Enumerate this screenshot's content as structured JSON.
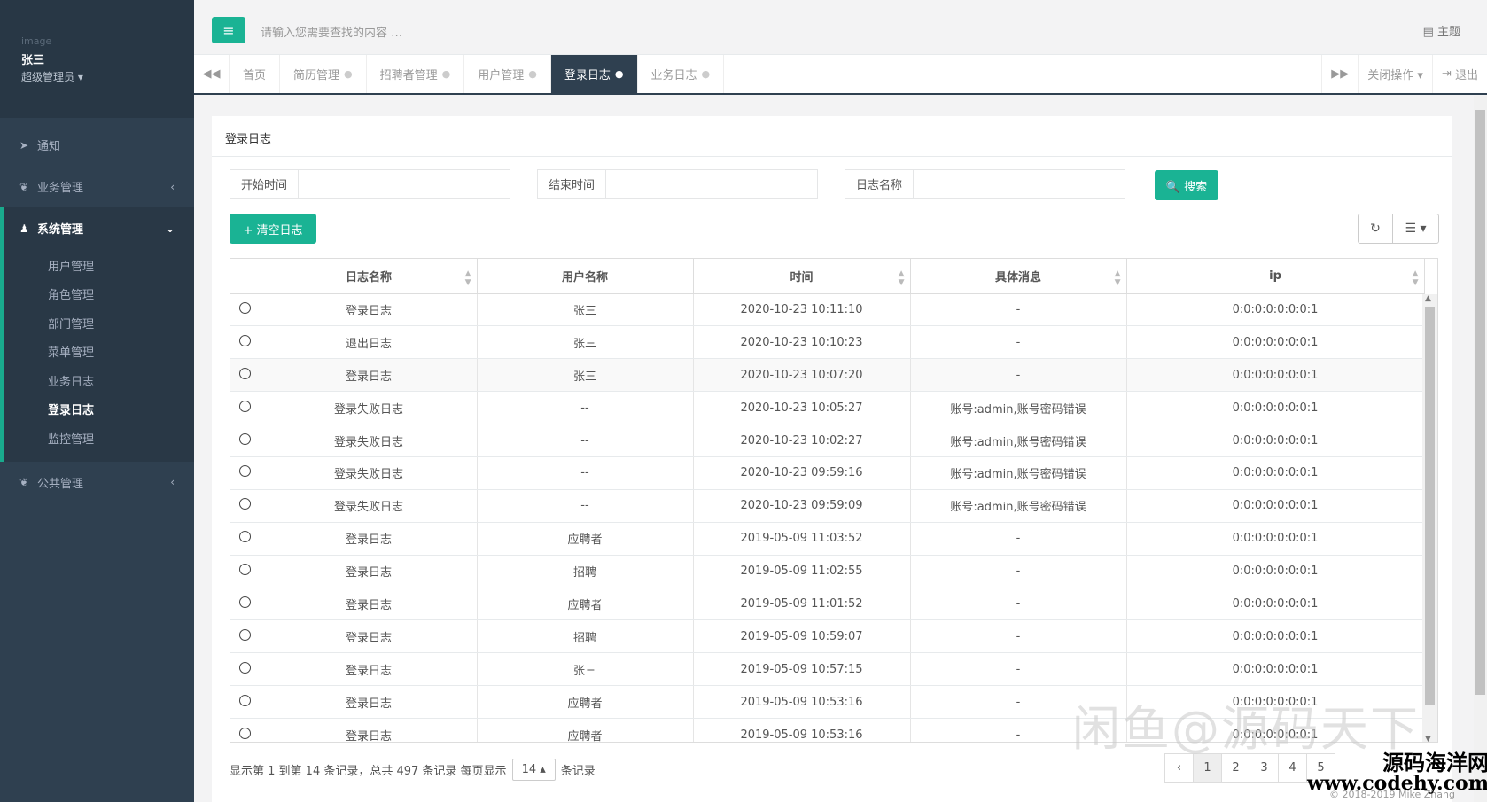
{
  "sidebar": {
    "profile": {
      "image_alt": "image",
      "name": "张三",
      "role": "超级管理员 ▾"
    },
    "items": [
      {
        "label": "通知",
        "icon": "paper-plane-icon"
      },
      {
        "label": "业务管理",
        "icon": "leaf-icon",
        "arrow": "‹"
      },
      {
        "label": "系统管理",
        "icon": "user-icon",
        "arrow": "⌄"
      },
      {
        "label": "公共管理",
        "icon": "leaf-icon",
        "arrow": "‹"
      }
    ],
    "sub_items": [
      "用户管理",
      "角色管理",
      "部门管理",
      "菜单管理",
      "业务日志",
      "登录日志",
      "监控管理"
    ]
  },
  "topbar": {
    "menu_icon": "≡",
    "search_placeholder": "请输入您需要查找的内容 …",
    "theme_label": "▤ 主题"
  },
  "tabs": {
    "prev": "◀◀",
    "next": "▶▶",
    "items": [
      {
        "label": "首页",
        "close": ""
      },
      {
        "label": "简历管理",
        "close": "●"
      },
      {
        "label": "招聘者管理",
        "close": "●"
      },
      {
        "label": "用户管理",
        "close": "●"
      },
      {
        "label": "登录日志",
        "close": "●"
      },
      {
        "label": "业务日志",
        "close": "●"
      }
    ],
    "close_ops": "关闭操作 ▾",
    "logout": "退出"
  },
  "panel": {
    "title": "登录日志",
    "filters": {
      "start_label": "开始时间",
      "end_label": "结束时间",
      "name_label": "日志名称"
    },
    "search_button": "🔍 搜索",
    "clear_button": "+ 清空日志",
    "refresh_icon": "↻",
    "columns_icon": "☰ ▾"
  },
  "table": {
    "headers": [
      "日志名称",
      "用户名称",
      "时间",
      "具体消息",
      "ip"
    ],
    "rows": [
      [
        "登录日志",
        "张三",
        "2020-10-23 10:11:10",
        "-",
        "0:0:0:0:0:0:0:1"
      ],
      [
        "退出日志",
        "张三",
        "2020-10-23 10:10:23",
        "-",
        "0:0:0:0:0:0:0:1"
      ],
      [
        "登录日志",
        "张三",
        "2020-10-23 10:07:20",
        "-",
        "0:0:0:0:0:0:0:1"
      ],
      [
        "登录失败日志",
        "--",
        "2020-10-23 10:05:27",
        "账号:admin,账号密码错误",
        "0:0:0:0:0:0:0:1"
      ],
      [
        "登录失败日志",
        "--",
        "2020-10-23 10:02:27",
        "账号:admin,账号密码错误",
        "0:0:0:0:0:0:0:1"
      ],
      [
        "登录失败日志",
        "--",
        "2020-10-23 09:59:16",
        "账号:admin,账号密码错误",
        "0:0:0:0:0:0:0:1"
      ],
      [
        "登录失败日志",
        "--",
        "2020-10-23 09:59:09",
        "账号:admin,账号密码错误",
        "0:0:0:0:0:0:0:1"
      ],
      [
        "登录日志",
        "应聘者",
        "2019-05-09 11:03:52",
        "-",
        "0:0:0:0:0:0:0:1"
      ],
      [
        "登录日志",
        "招聘",
        "2019-05-09 11:02:55",
        "-",
        "0:0:0:0:0:0:0:1"
      ],
      [
        "登录日志",
        "应聘者",
        "2019-05-09 11:01:52",
        "-",
        "0:0:0:0:0:0:0:1"
      ],
      [
        "登录日志",
        "招聘",
        "2019-05-09 10:59:07",
        "-",
        "0:0:0:0:0:0:0:1"
      ],
      [
        "登录日志",
        "张三",
        "2019-05-09 10:57:15",
        "-",
        "0:0:0:0:0:0:0:1"
      ],
      [
        "登录日志",
        "应聘者",
        "2019-05-09 10:53:16",
        "-",
        "0:0:0:0:0:0:0:1"
      ],
      [
        "登录日志",
        "应聘者",
        "2019-05-09 10:53:16",
        "-",
        "0:0:0:0:0:0:0:1"
      ]
    ]
  },
  "pagination": {
    "info_prefix": "显示第 1 到第 14 条记录，总共 497 条记录 每页显示",
    "page_size": "14 ▴",
    "info_suffix": "条记录",
    "pages": [
      "‹",
      "1",
      "2",
      "3",
      "4",
      "5"
    ]
  },
  "watermark": {
    "overlay": "闲鱼@源码天下",
    "site_cn": "源码海洋网",
    "site_url": "www.codehy.com",
    "copyright": "© 2018-2019 Mike Zhang"
  }
}
